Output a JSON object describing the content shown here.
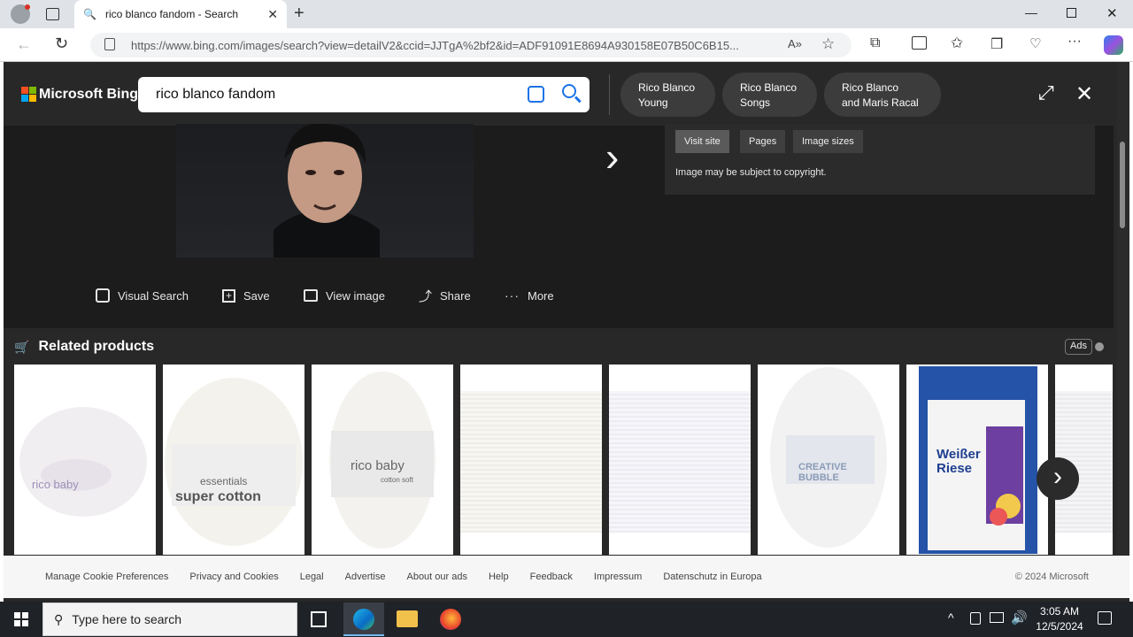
{
  "browser": {
    "tab_title": "rico blanco fandom - Search",
    "url": "https://www.bing.com/images/search?view=detailV2&ccid=JJTgA%2bf2&id=ADF91091E8694A930158E07B50C6B15..."
  },
  "bing": {
    "logo": "Microsoft Bing",
    "query": "rico blanco fandom",
    "related_chips": [
      {
        "line1": "Rico Blanco",
        "line2": "Young"
      },
      {
        "line1": "Rico Blanco",
        "line2": "Songs"
      },
      {
        "line1": "Rico Blanco",
        "line2": "and Maris Racal"
      }
    ]
  },
  "detail": {
    "pills": [
      "Visit site",
      "Pages",
      "Image sizes"
    ],
    "copyright": "Image may be subject to copyright.",
    "actions": [
      "Visual Search",
      "Save",
      "View image",
      "Share",
      "More"
    ]
  },
  "related": {
    "heading": "Related products",
    "ads_label": "Ads",
    "products": [
      {
        "brand": "rico baby"
      },
      {
        "line1": "essentials",
        "line2": "super cotton"
      },
      {
        "brand": "rico baby",
        "sub": "cotton soft"
      },
      {},
      {},
      {
        "brand": "CREATIVE BUBBLE"
      },
      {
        "brand": "Weißer Riese"
      },
      {}
    ]
  },
  "footer": {
    "links": [
      "Manage Cookie Preferences",
      "Privacy and Cookies",
      "Legal",
      "Advertise",
      "About our ads",
      "Help",
      "Feedback",
      "Impressum",
      "Datenschutz in Europa"
    ],
    "copyright": "© 2024 Microsoft"
  },
  "taskbar": {
    "search_placeholder": "Type here to search",
    "time": "3:05 AM",
    "date": "12/5/2024"
  },
  "colors": {
    "bing_bg": "#282828",
    "accent": "#0078d4"
  }
}
